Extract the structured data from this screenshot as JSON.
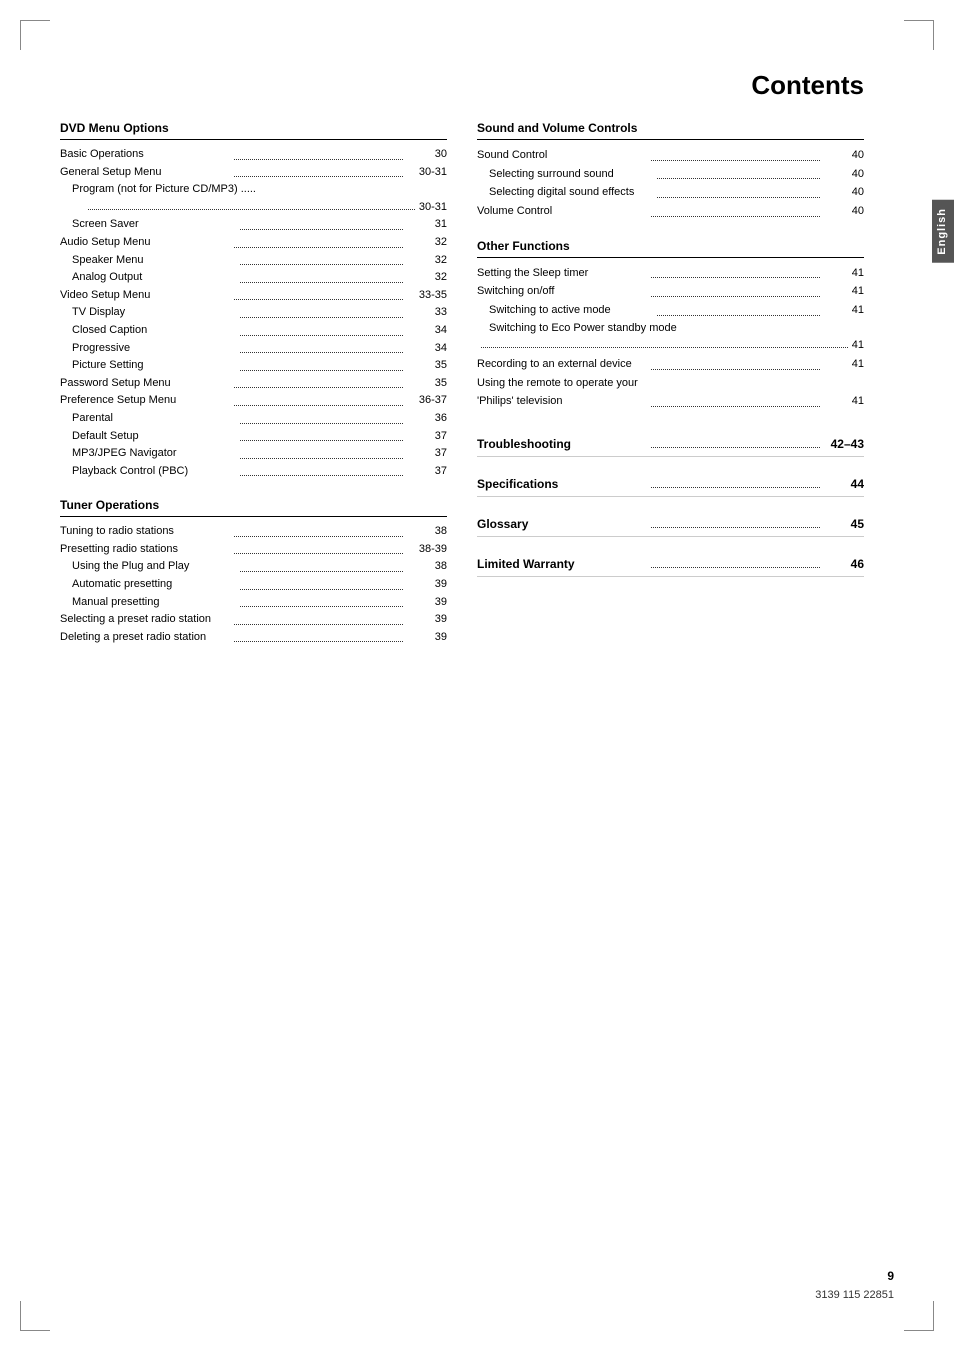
{
  "page": {
    "title": "Contents",
    "english_label": "English",
    "page_number": "9",
    "product_code": "3139 115 22851"
  },
  "left_column": {
    "section1": {
      "header": "DVD Menu Options",
      "entries": [
        {
          "label": "Basic Operations",
          "page": "30",
          "indent": 0
        },
        {
          "label": "General Setup Menu",
          "page": "30-31",
          "indent": 0
        },
        {
          "label": "Program (not for Picture CD/MP3)",
          "page": "30-31",
          "indent": 1,
          "wrap": true
        },
        {
          "label": "Screen Saver",
          "page": "31",
          "indent": 1
        },
        {
          "label": "Audio Setup Menu",
          "page": "32",
          "indent": 0
        },
        {
          "label": "Speaker Menu",
          "page": "32",
          "indent": 1
        },
        {
          "label": "Analog Output",
          "page": "32",
          "indent": 1
        },
        {
          "label": "Video Setup Menu",
          "page": "33-35",
          "indent": 0
        },
        {
          "label": "TV Display",
          "page": "33",
          "indent": 1
        },
        {
          "label": "Closed Caption",
          "page": "34",
          "indent": 1
        },
        {
          "label": "Progressive",
          "page": "34",
          "indent": 1
        },
        {
          "label": "Picture Setting",
          "page": "35",
          "indent": 1
        },
        {
          "label": "Password Setup Menu",
          "page": "35",
          "indent": 0
        },
        {
          "label": "Preference Setup Menu",
          "page": "36-37",
          "indent": 0
        },
        {
          "label": "Parental",
          "page": "36",
          "indent": 1
        },
        {
          "label": "Default Setup",
          "page": "37",
          "indent": 1
        },
        {
          "label": "MP3/JPEG Navigator",
          "page": "37",
          "indent": 1
        },
        {
          "label": "Playback Control (PBC)",
          "page": "37",
          "indent": 1
        }
      ]
    },
    "section2": {
      "header": "Tuner Operations",
      "entries": [
        {
          "label": "Tuning to radio stations",
          "page": "38",
          "indent": 0
        },
        {
          "label": "Presetting radio stations",
          "page": "38-39",
          "indent": 0
        },
        {
          "label": "Using the Plug and Play",
          "page": "38",
          "indent": 1
        },
        {
          "label": "Automatic presetting",
          "page": "39",
          "indent": 1
        },
        {
          "label": "Manual presetting",
          "page": "39",
          "indent": 1
        },
        {
          "label": "Selecting a preset radio station",
          "page": "39",
          "indent": 0
        },
        {
          "label": "Deleting a preset radio station",
          "page": "39",
          "indent": 0
        }
      ]
    }
  },
  "right_column": {
    "section1": {
      "header": "Sound and Volume Controls",
      "entries": [
        {
          "label": "Sound Control",
          "page": "40",
          "indent": 0
        },
        {
          "label": "Selecting surround sound",
          "page": "40",
          "indent": 1
        },
        {
          "label": "Selecting digital sound effects",
          "page": "40",
          "indent": 1
        },
        {
          "label": "Volume Control",
          "page": "40",
          "indent": 0
        }
      ]
    },
    "section2": {
      "header": "Other Functions",
      "entries": [
        {
          "label": "Setting the Sleep timer",
          "page": "41",
          "indent": 0
        },
        {
          "label": "Switching on/off",
          "page": "41",
          "indent": 0
        },
        {
          "label": "Switching to active mode",
          "page": "41",
          "indent": 1
        },
        {
          "label": "Switching to Eco Power standby mode",
          "page": "41",
          "indent": 1,
          "wrap": true
        },
        {
          "label": "Recording to an external device",
          "page": "41",
          "indent": 0
        },
        {
          "label": "Using the remote to operate your",
          "page": "",
          "indent": 0,
          "nopage": true
        },
        {
          "label": "'Philips' television",
          "page": "41",
          "indent": 0
        }
      ]
    },
    "standalone": [
      {
        "label": "Troubleshooting",
        "page": "42–43"
      },
      {
        "label": "Specifications",
        "page": "44"
      },
      {
        "label": "Glossary",
        "page": "45"
      },
      {
        "label": "Limited Warranty",
        "page": "46"
      }
    ]
  }
}
